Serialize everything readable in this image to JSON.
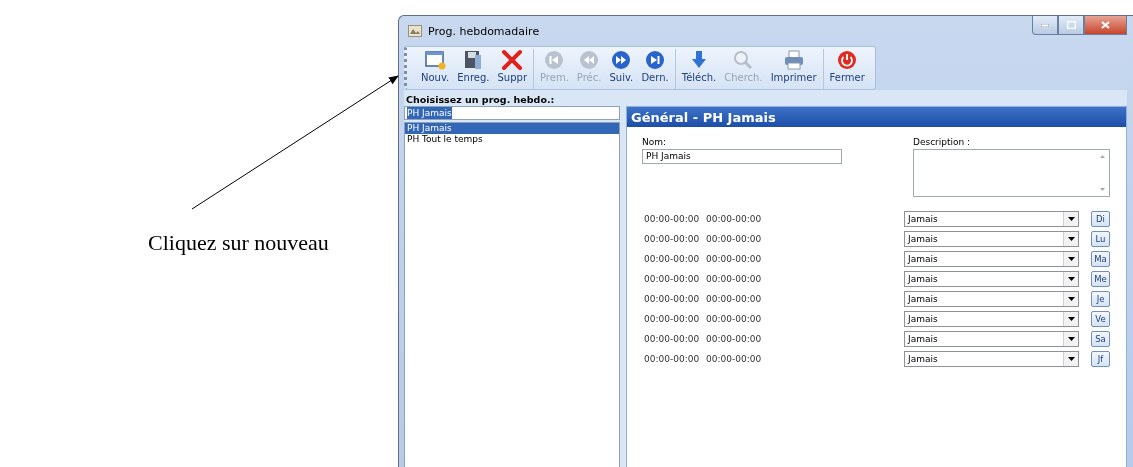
{
  "annotation": {
    "text": "Cliquez sur nouveau"
  },
  "window": {
    "title": "Prog. hebdomadaire"
  },
  "toolbar": {
    "groups": [
      [
        {
          "kind": "new",
          "label": "Nouv.",
          "disabled": false
        },
        {
          "kind": "save",
          "label": "Enreg.",
          "disabled": false
        },
        {
          "kind": "delete",
          "label": "Suppr",
          "disabled": false
        }
      ],
      [
        {
          "kind": "first",
          "label": "Prem.",
          "disabled": true
        },
        {
          "kind": "prev",
          "label": "Préc.",
          "disabled": true
        },
        {
          "kind": "next",
          "label": "Suiv.",
          "disabled": false
        },
        {
          "kind": "last",
          "label": "Dern.",
          "disabled": false
        }
      ],
      [
        {
          "kind": "download",
          "label": "Téléch.",
          "disabled": false
        },
        {
          "kind": "search",
          "label": "Cherch.",
          "disabled": true
        },
        {
          "kind": "print",
          "label": "Imprimer",
          "disabled": false
        }
      ],
      [
        {
          "kind": "power",
          "label": "Fermer",
          "disabled": false
        }
      ]
    ]
  },
  "picker": {
    "label": "Choisissez un prog. hebdo.:",
    "value": "PH Jamais",
    "items": [
      {
        "label": "PH Jamais",
        "selected": true
      },
      {
        "label": "PH Tout le temps",
        "selected": false
      }
    ]
  },
  "detail": {
    "header": "Général - PH Jamais",
    "name_label": "Nom:",
    "name_value": "PH Jamais",
    "description_label": "Description :",
    "days": [
      {
        "slot_1": "00:00-00:00",
        "slot_2": "00:00-00:00",
        "mode": "Jamais",
        "day": "Di"
      },
      {
        "slot_1": "00:00-00:00",
        "slot_2": "00:00-00:00",
        "mode": "Jamais",
        "day": "Lu"
      },
      {
        "slot_1": "00:00-00:00",
        "slot_2": "00:00-00:00",
        "mode": "Jamais",
        "day": "Ma"
      },
      {
        "slot_1": "00:00-00:00",
        "slot_2": "00:00-00:00",
        "mode": "Jamais",
        "day": "Me"
      },
      {
        "slot_1": "00:00-00:00",
        "slot_2": "00:00-00:00",
        "mode": "Jamais",
        "day": "Je"
      },
      {
        "slot_1": "00:00-00:00",
        "slot_2": "00:00-00:00",
        "mode": "Jamais",
        "day": "Ve"
      },
      {
        "slot_1": "00:00-00:00",
        "slot_2": "00:00-00:00",
        "mode": "Jamais",
        "day": "Sa"
      },
      {
        "slot_1": "00:00-00:00",
        "slot_2": "00:00-00:00",
        "mode": "Jamais",
        "day": "Jf"
      }
    ]
  }
}
